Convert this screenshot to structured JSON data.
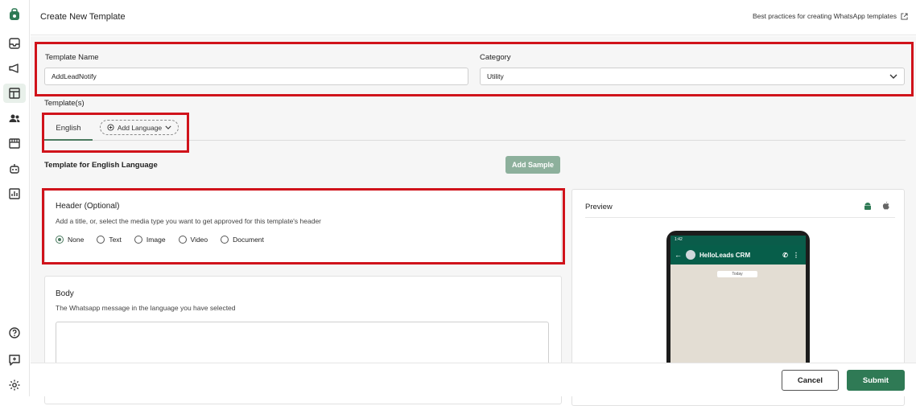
{
  "header": {
    "title": "Create New Template",
    "best_practices": "Best practices for creating WhatsApp templates"
  },
  "form": {
    "template_name_label": "Template Name",
    "template_name_value": "AddLeadNotify",
    "category_label": "Category",
    "category_value": "Utility",
    "templates_label": "Template(s)"
  },
  "tabs": {
    "english": "English",
    "add_language": "Add Language"
  },
  "section": {
    "title": "Template for English Language",
    "add_sample": "Add Sample"
  },
  "header_card": {
    "title": "Header (Optional)",
    "description": "Add a title, or, select the media type you want to get approved for this template's header",
    "options": [
      "None",
      "Text",
      "Image",
      "Video",
      "Document"
    ],
    "selected": "None"
  },
  "body_card": {
    "title": "Body",
    "description": "The Whatsapp message in the language you have selected"
  },
  "preview": {
    "title": "Preview",
    "phone_time": "1:42",
    "contact": "HelloLeads CRM",
    "today": "Today"
  },
  "footer": {
    "cancel": "Cancel",
    "submit": "Submit"
  },
  "colors": {
    "accent": "#2f7a55",
    "highlight": "#d0131b"
  }
}
